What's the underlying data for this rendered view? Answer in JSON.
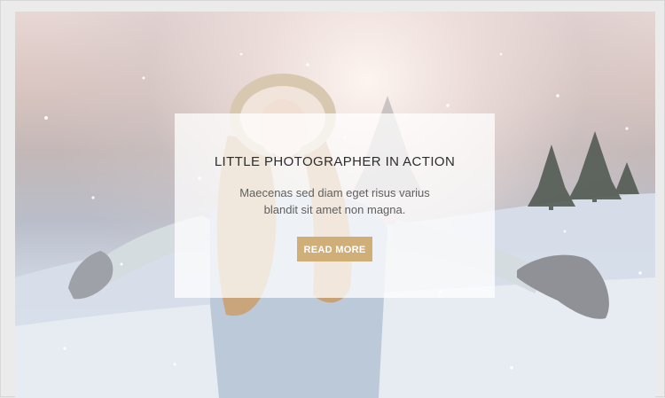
{
  "hero": {
    "title": "LITTLE PHOTOGRAPHER IN ACTION",
    "description": "Maecenas sed diam eget risus varius blandit sit amet non magna.",
    "button_label": "READ MORE",
    "accent_color": "#cfae78"
  }
}
